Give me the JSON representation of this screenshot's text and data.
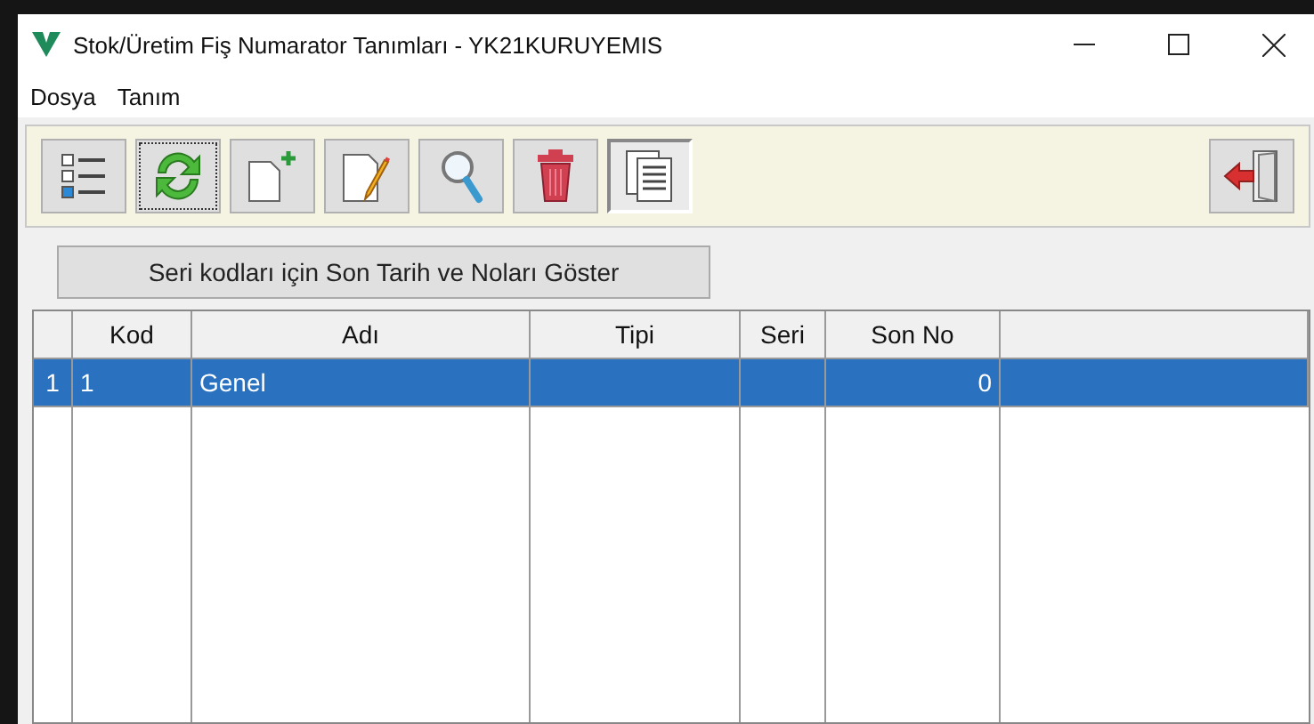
{
  "window": {
    "title": "Stok/Üretim Fiş Numarator Tanımları - YK21KURUYEMIS"
  },
  "menu": [
    "Dosya",
    "Tanım"
  ],
  "toolbar": [
    {
      "kind": "list",
      "pressed": false,
      "focused": false
    },
    {
      "kind": "refresh",
      "pressed": false,
      "focused": true
    },
    {
      "kind": "new",
      "pressed": false,
      "focused": false
    },
    {
      "kind": "edit",
      "pressed": false,
      "focused": false
    },
    {
      "kind": "search",
      "pressed": false,
      "focused": false
    },
    {
      "kind": "delete",
      "pressed": false,
      "focused": false
    },
    {
      "kind": "copy",
      "pressed": true,
      "focused": false
    }
  ],
  "exit_button": {
    "kind": "exit"
  },
  "show_button": "Seri kodları için Son Tarih ve Noları Göster",
  "table": {
    "columns": [
      "Kod",
      "Adı",
      "Tipi",
      "Seri",
      "Son No"
    ],
    "rows": [
      {
        "number": "1",
        "cells": [
          "1",
          "Genel",
          "",
          "",
          "0"
        ],
        "selected": true
      }
    ]
  }
}
